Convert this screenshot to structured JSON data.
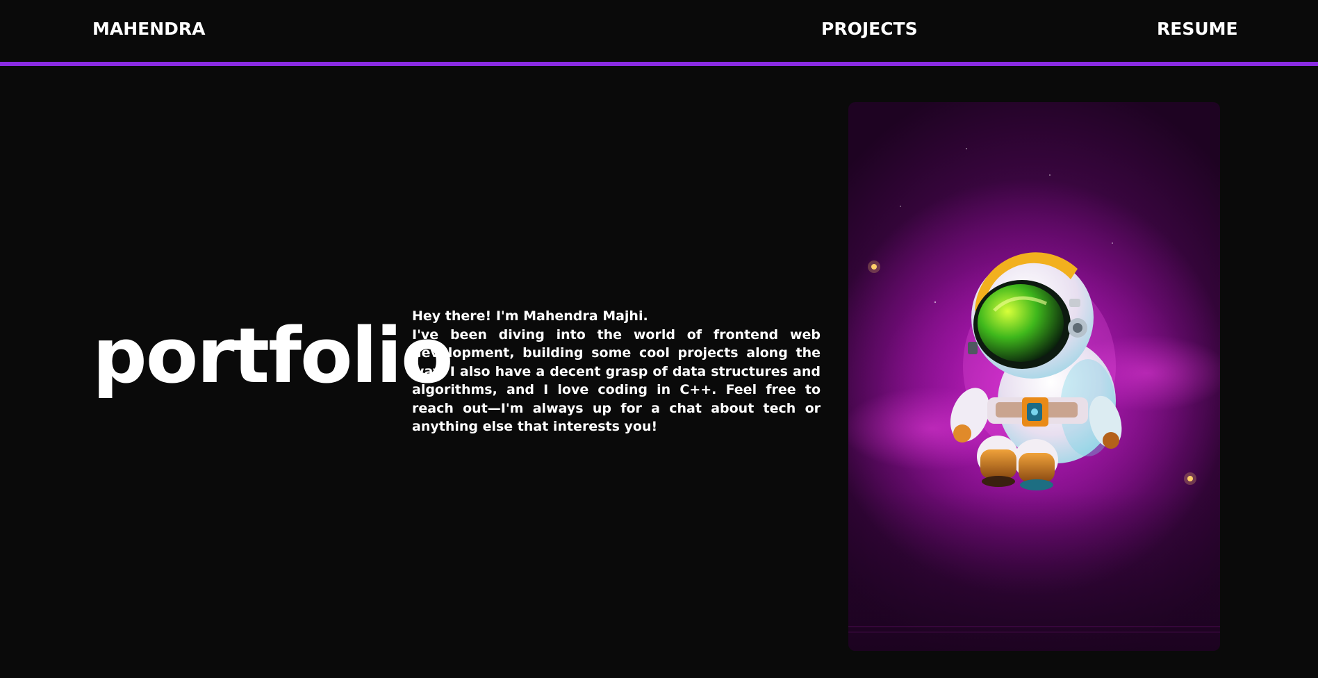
{
  "nav": {
    "brand": "MAHENDRA",
    "projects": "PROJECTS",
    "resume": "RESUME"
  },
  "hero": {
    "title": "portfolio",
    "greeting": "Hey there! I'm Mahendra Majhi.",
    "bio": "I've been diving into the world of frontend web development, building some cool projects along the way. I also have a decent grasp of data structures and algorithms, and I love coding in C++. Feel free to reach out—I'm always up for a chat about tech or anything else that interests you!"
  },
  "colors": {
    "background": "#0a0a0a",
    "accent": "#8a2be2",
    "text": "#ffffff",
    "image_glow": "#c21bc0"
  },
  "image": {
    "subject": "astronaut-illustration"
  }
}
